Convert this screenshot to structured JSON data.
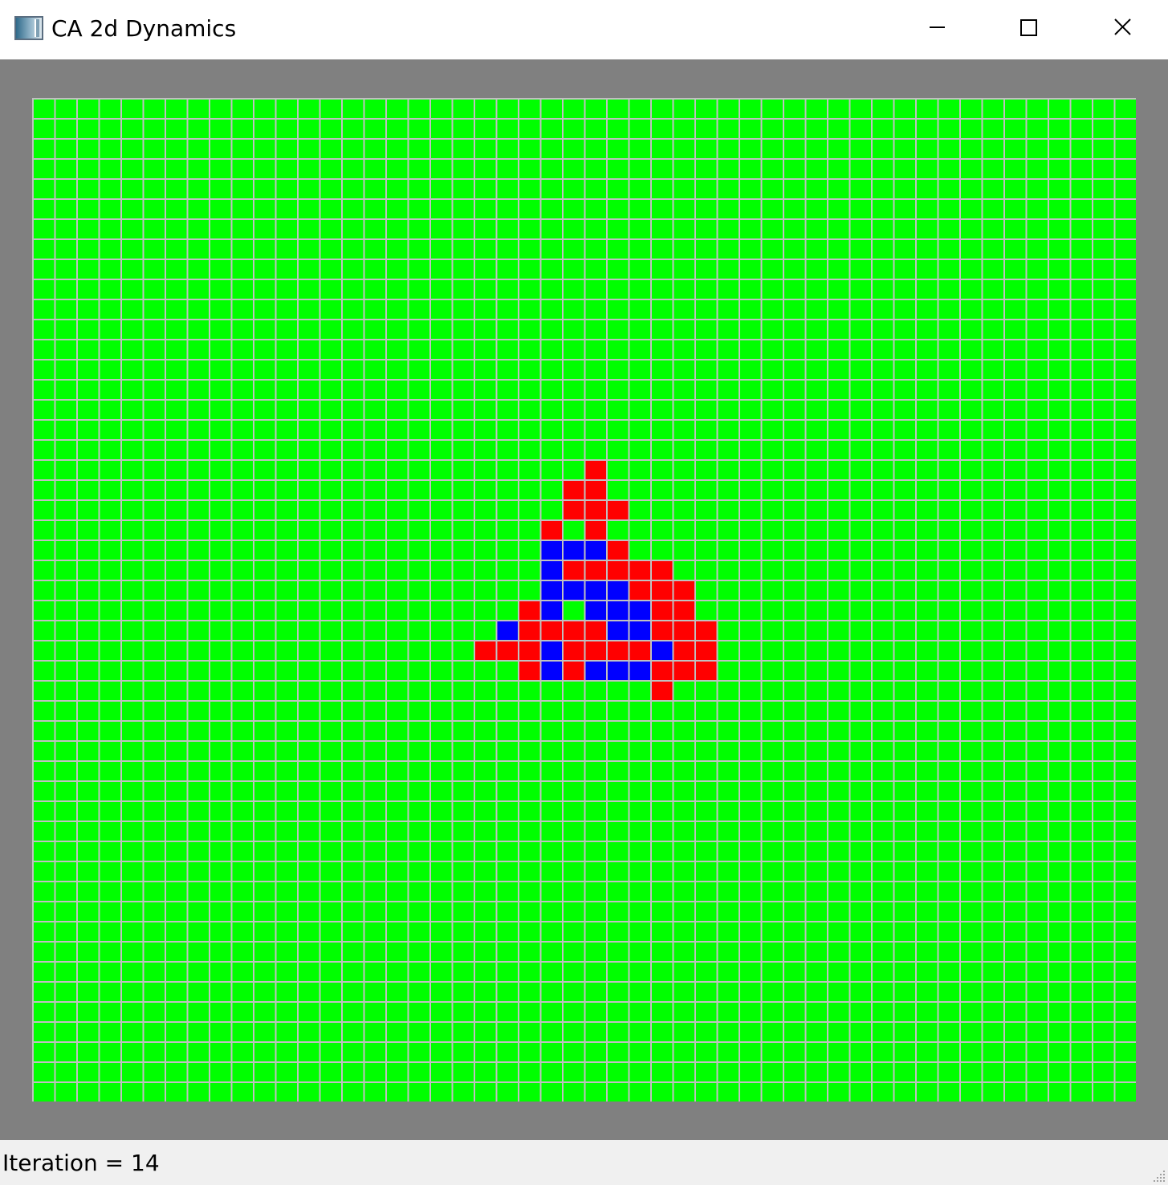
{
  "window": {
    "title": "CA 2d Dynamics",
    "icon": "application-icon",
    "controls": [
      "minimize-icon",
      "maximize-icon",
      "close-icon"
    ]
  },
  "grid": {
    "columns": 50,
    "rows": 50,
    "colors": {
      "background": "#00ff00",
      "red": "#ff0000",
      "blue": "#0000ff",
      "gridline": "#c0c0c0",
      "border": "#808080"
    },
    "red_cells": [
      [
        25,
        18
      ],
      [
        24,
        19
      ],
      [
        25,
        19
      ],
      [
        24,
        20
      ],
      [
        25,
        20
      ],
      [
        26,
        20
      ],
      [
        23,
        21
      ],
      [
        25,
        21
      ],
      [
        26,
        22
      ],
      [
        24,
        23
      ],
      [
        25,
        23
      ],
      [
        26,
        23
      ],
      [
        27,
        23
      ],
      [
        28,
        23
      ],
      [
        27,
        24
      ],
      [
        28,
        24
      ],
      [
        29,
        24
      ],
      [
        22,
        25
      ],
      [
        28,
        25
      ],
      [
        29,
        25
      ],
      [
        22,
        26
      ],
      [
        23,
        26
      ],
      [
        24,
        26
      ],
      [
        25,
        26
      ],
      [
        28,
        26
      ],
      [
        29,
        26
      ],
      [
        30,
        26
      ],
      [
        20,
        27
      ],
      [
        21,
        27
      ],
      [
        22,
        27
      ],
      [
        24,
        27
      ],
      [
        25,
        27
      ],
      [
        26,
        27
      ],
      [
        27,
        27
      ],
      [
        29,
        27
      ],
      [
        30,
        27
      ],
      [
        22,
        28
      ],
      [
        24,
        28
      ],
      [
        28,
        28
      ],
      [
        29,
        28
      ],
      [
        30,
        28
      ],
      [
        28,
        29
      ]
    ],
    "blue_cells": [
      [
        23,
        22
      ],
      [
        24,
        22
      ],
      [
        25,
        22
      ],
      [
        23,
        23
      ],
      [
        23,
        24
      ],
      [
        24,
        24
      ],
      [
        25,
        24
      ],
      [
        26,
        24
      ],
      [
        23,
        25
      ],
      [
        25,
        25
      ],
      [
        26,
        25
      ],
      [
        27,
        25
      ],
      [
        21,
        26
      ],
      [
        26,
        26
      ],
      [
        27,
        26
      ],
      [
        23,
        27
      ],
      [
        28,
        27
      ],
      [
        23,
        28
      ],
      [
        25,
        28
      ],
      [
        26,
        28
      ],
      [
        27,
        28
      ]
    ]
  },
  "status": {
    "text": "Iteration = 14"
  }
}
